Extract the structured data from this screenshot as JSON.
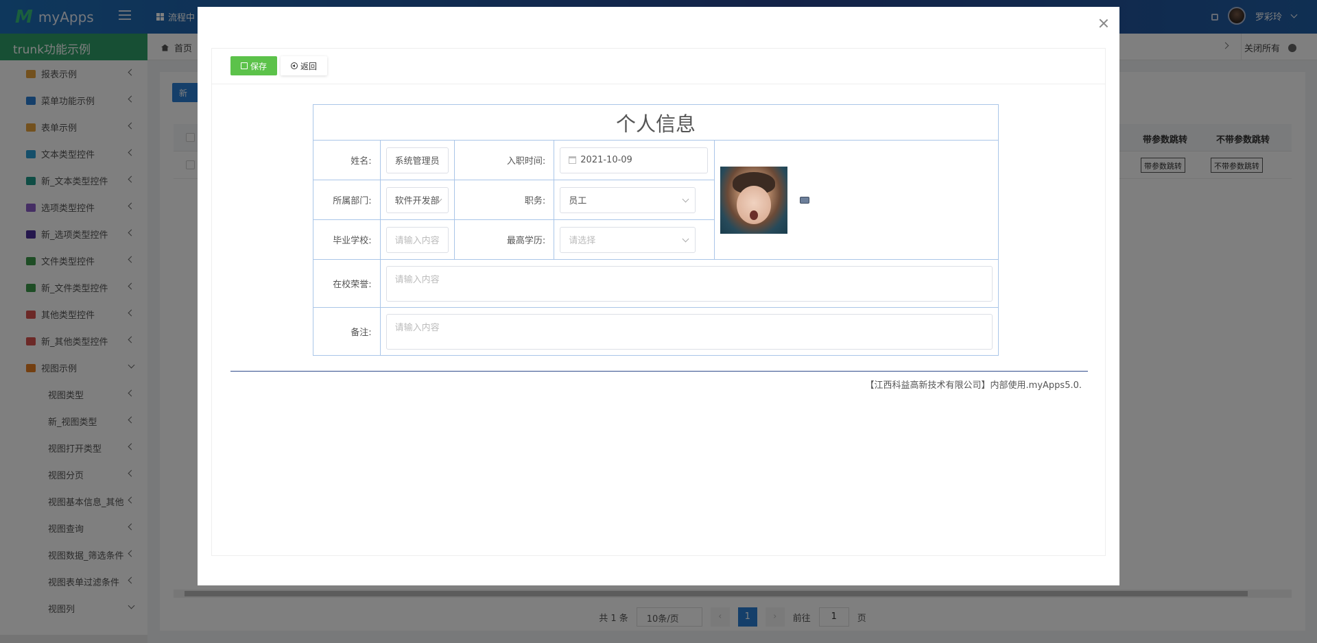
{
  "app": {
    "name": "myApps",
    "topnav_label": "流程中",
    "user_name": "罗彩玲"
  },
  "sidebar": {
    "title": "trunk功能示例",
    "items": [
      {
        "label": "报表示例",
        "icon": "chart-icon",
        "color": "#e6a23c"
      },
      {
        "label": "菜单功能示例",
        "icon": "list-icon",
        "color": "#2a7fd4"
      },
      {
        "label": "表单示例",
        "icon": "table-icon",
        "color": "#e6a23c"
      },
      {
        "label": "文本类型控件",
        "icon": "file-text-icon",
        "color": "#2a9fd4"
      },
      {
        "label": "新_文本类型控件",
        "icon": "file-text-icon",
        "color": "#1f9a8a"
      },
      {
        "label": "选项类型控件",
        "icon": "checkbox-icon",
        "color": "#8a5cc9"
      },
      {
        "label": "新_选项类型控件",
        "icon": "checkbox-icon",
        "color": "#4b2f9a"
      },
      {
        "label": "文件类型控件",
        "icon": "folder-open-icon",
        "color": "#3c9a4a"
      },
      {
        "label": "新_文件类型控件",
        "icon": "folder-open-icon",
        "color": "#3c9a4a"
      },
      {
        "label": "其他类型控件",
        "icon": "cube-icon",
        "color": "#d9534f"
      },
      {
        "label": "新_其他类型控件",
        "icon": "cubes-icon",
        "color": "#d9534f"
      },
      {
        "label": "视图示例",
        "icon": "columns-icon",
        "color": "#e67e22"
      }
    ],
    "sub_items": [
      {
        "label": "视图类型"
      },
      {
        "label": "新_视图类型"
      },
      {
        "label": "视图打开类型"
      },
      {
        "label": "视图分页"
      },
      {
        "label": "视图基本信息_其他"
      },
      {
        "label": "视图查询"
      },
      {
        "label": "视图数据_筛选条件"
      },
      {
        "label": "视图表单过滤条件"
      },
      {
        "label": "视图列"
      }
    ]
  },
  "tabs": {
    "home": "首页",
    "close_all": "关闭所有"
  },
  "background_view": {
    "new_button": "新",
    "columns": [
      "带参数跳转",
      "不带参数跳转"
    ],
    "row_buttons": [
      "带参数跳转",
      "不带参数跳转"
    ],
    "pager": {
      "total": "共 1 条",
      "page_size": "10条/页",
      "current_page": "1",
      "goto_prefix": "前往",
      "goto_value": "1",
      "goto_suffix": "页"
    }
  },
  "dialog": {
    "save_label": "保存",
    "back_label": "返回",
    "form_title": "个人信息",
    "fields": {
      "name": {
        "label": "姓名:",
        "value": "系统管理员"
      },
      "join_date": {
        "label": "入职时间:",
        "value": "2021-10-09"
      },
      "department": {
        "label": "所属部门:",
        "value": "软件开发部"
      },
      "position": {
        "label": "职务:",
        "value": "员工"
      },
      "school": {
        "label": "毕业学校:",
        "placeholder": "请输入内容"
      },
      "education": {
        "label": "最高学历:",
        "placeholder": "请选择"
      },
      "honors": {
        "label": "在校荣誉:",
        "placeholder": "请输入内容"
      },
      "remark": {
        "label": "备注:",
        "placeholder": "请输入内容"
      }
    },
    "footer_note": "【江西科益高新技术有限公司】内部使用.myApps5.0."
  },
  "colors": {
    "accent": "#2a7fd4",
    "save_green": "#5cc24a",
    "sidebar_title": "#2f9f69",
    "border": "#a9c5e8"
  }
}
